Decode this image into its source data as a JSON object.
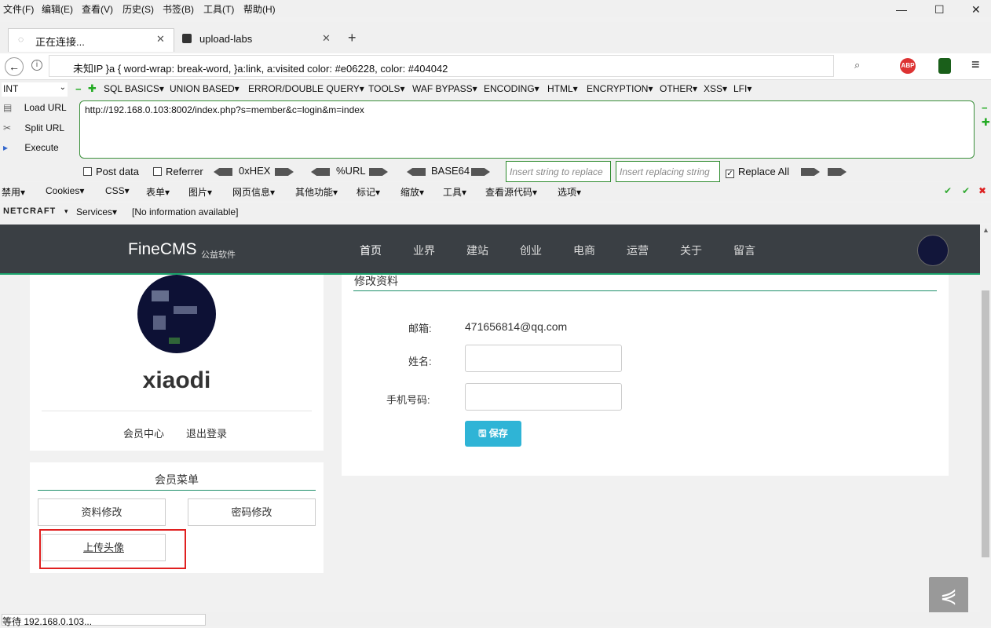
{
  "menu": [
    "文件(F)",
    "编辑(E)",
    "查看(V)",
    "历史(S)",
    "书签(B)",
    "工具(T)",
    "帮助(H)"
  ],
  "tabs": [
    {
      "label": "正在连接..."
    },
    {
      "label": "upload-labs"
    }
  ],
  "address": "未知IP   }a { word-wrap: break-word, }a:link, a:visited color: #e06228, color: #404042",
  "hackbar": {
    "select": "INT",
    "menus": [
      "SQL BASICS▾",
      "UNION BASED▾",
      "ERROR/DOUBLE QUERY▾",
      "TOOLS▾",
      "WAF BYPASS▾",
      "ENCODING▾",
      "HTML▾",
      "ENCRYPTION▾",
      "OTHER▾",
      "XSS▾",
      "LFI▾"
    ],
    "load_url": "Load URL",
    "split_url": "Split URL",
    "execute": "Execute",
    "url": "http://192.168.0.103:8002/index.php?s=member&c=login&m=index",
    "post_data": "Post data",
    "referrer": "Referrer",
    "hex": "0xHEX",
    "url_enc": "%URL",
    "base64": "BASE64",
    "insert_ph": "Insert string to replace",
    "replacing_ph": "Insert replacing string",
    "replace_all": "Replace All"
  },
  "toolbar2": [
    "禁用▾",
    "Cookies▾",
    "CSS▾",
    "表单▾",
    "图片▾",
    "网页信息▾",
    "其他功能▾",
    "标记▾",
    "缩放▾",
    "工具▾",
    "查看源代码▾",
    "选项▾"
  ],
  "toolbar3": {
    "netcraft": "NETCRAFT",
    "services": "Services▾",
    "info": "[No information available]"
  },
  "site": {
    "logo": "FineCMS",
    "logo_sub": "公益软件",
    "nav": [
      "首页",
      "业界",
      "建站",
      "创业",
      "电商",
      "运营",
      "关于",
      "留言"
    ],
    "username": "xiaodi",
    "member_center": "会员中心",
    "logout": "退出登录",
    "member_menu": "会员菜单",
    "btn_profile": "资料修改",
    "btn_password": "密码修改",
    "btn_avatar": "上传头像",
    "edit_title": "修改资料",
    "email_label": "邮箱:",
    "email_value": "471656814@qq.com",
    "name_label": "姓名:",
    "phone_label": "手机号码:",
    "save": "保存"
  },
  "status": "等待 192.168.0.103..."
}
